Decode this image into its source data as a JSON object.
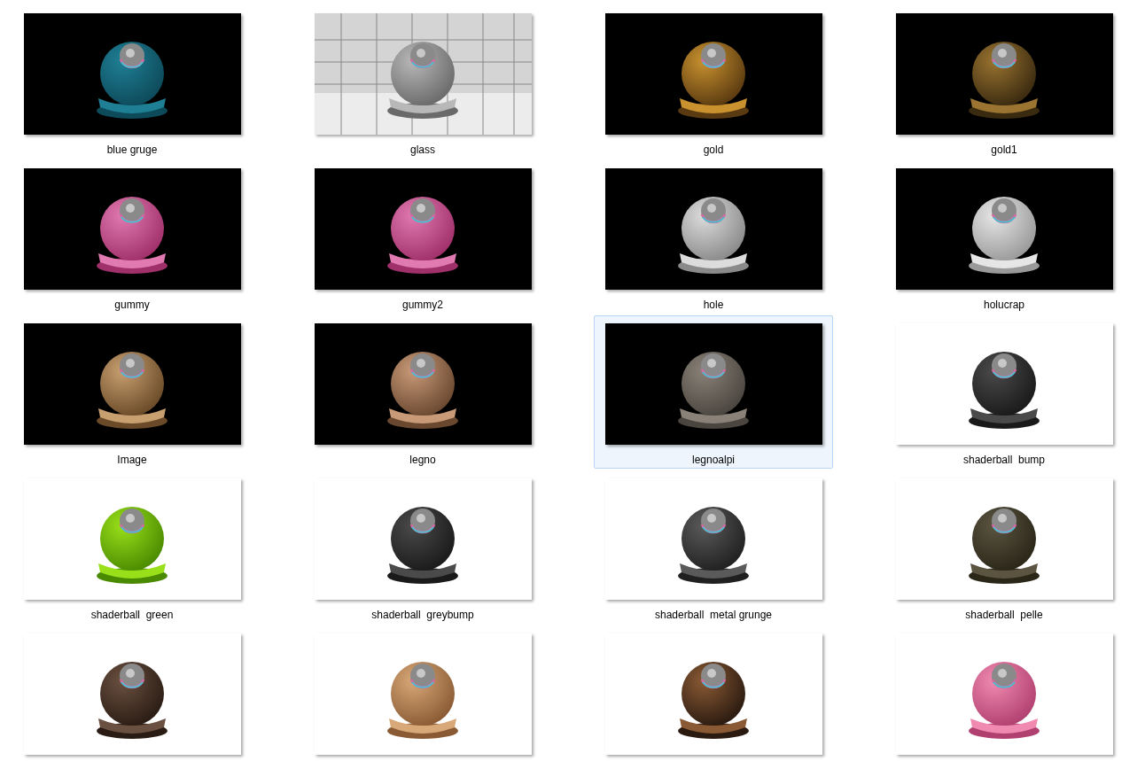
{
  "items": [
    {
      "label": "blue gruge",
      "selected": false
    },
    {
      "label": "glass",
      "selected": false
    },
    {
      "label": "gold",
      "selected": false
    },
    {
      "label": "gold1",
      "selected": false
    },
    {
      "label": "gummy",
      "selected": false
    },
    {
      "label": "gummy2",
      "selected": false
    },
    {
      "label": "hole",
      "selected": false
    },
    {
      "label": "holucrap",
      "selected": false
    },
    {
      "label": "Image",
      "selected": false
    },
    {
      "label": "legno",
      "selected": false
    },
    {
      "label": "legnoalpi",
      "selected": true
    },
    {
      "label": "shaderball  bump",
      "selected": false
    },
    {
      "label": "shaderball  green",
      "selected": false
    },
    {
      "label": "shaderball  greybump",
      "selected": false
    },
    {
      "label": "shaderball  metal grunge",
      "selected": false
    },
    {
      "label": "shaderball  pelle",
      "selected": false
    },
    {
      "selected": false
    },
    {
      "selected": false
    },
    {
      "selected": false
    },
    {
      "selected": false
    }
  ]
}
